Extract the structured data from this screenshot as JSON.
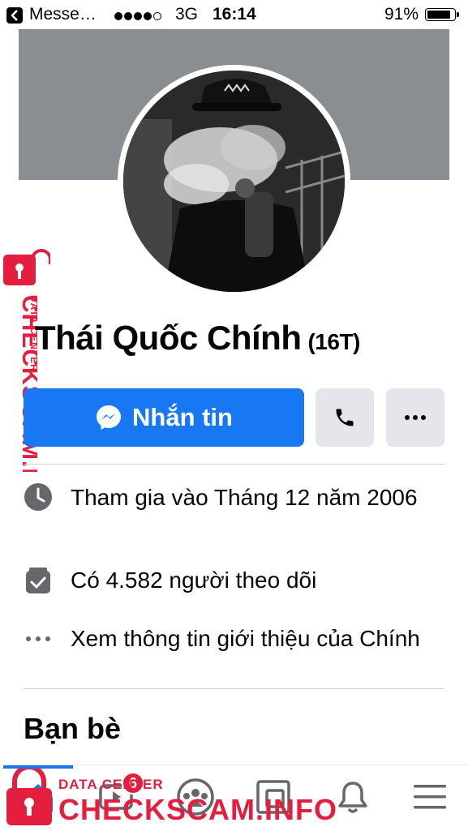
{
  "status_bar": {
    "back_app": "Messe…",
    "network": "3G",
    "time": "16:14",
    "battery": "91%",
    "battery_level": 0.91
  },
  "profile": {
    "name": "Thái Quốc Chính",
    "name_suffix": "(16T)"
  },
  "actions": {
    "message_label": "Nhắn tin"
  },
  "info": {
    "joined": "Tham gia vào Tháng 12 năm 2006",
    "followers": "Có 4.582 người theo dõi",
    "about": "Xem thông tin giới thiệu của Chính"
  },
  "friends": {
    "title": "Bạn bè"
  },
  "bottom_nav": {
    "badge": "6",
    "items": [
      "home-icon",
      "watch-icon",
      "groups-icon",
      "pages-icon",
      "bell-icon",
      "menu-icon"
    ]
  },
  "watermark": {
    "vertical_small": "DATA CENTER",
    "vertical_big": "CHECKSCAM.INFO",
    "bottom_small": "DATA CENTER",
    "bottom_big": "CHECKSCAM.INFO"
  },
  "colors": {
    "accent": "#1877f2",
    "watermark": "#e41e3f",
    "cover": "#8a8d91"
  }
}
